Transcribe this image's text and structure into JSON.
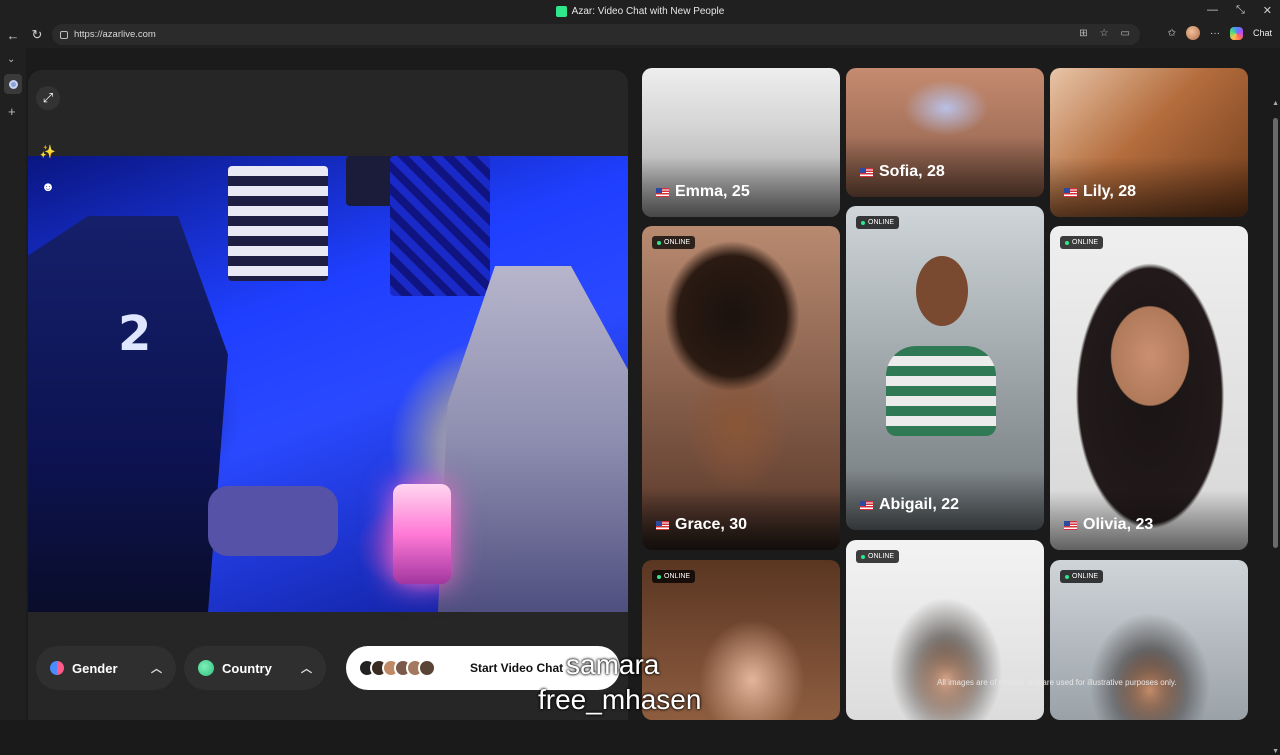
{
  "browser": {
    "window_title": "Azar: Video Chat with New People",
    "url": "https://azarlive.com",
    "chat_label": "Chat",
    "controls": [
      "—",
      "⤡",
      "✕"
    ]
  },
  "filters": {
    "gender_label": "Gender",
    "country_label": "Country",
    "start_label": "Start Video Chat"
  },
  "profiles": [
    {
      "name": "Emma, 25",
      "online": false
    },
    {
      "name": "Sofia, 28",
      "online": false
    },
    {
      "name": "Lily, 28",
      "online": false
    },
    {
      "name": "Grace, 30",
      "online": true
    },
    {
      "name": "Abigail, 22",
      "online": true
    },
    {
      "name": "Olivia, 23",
      "online": true
    },
    {
      "name": "",
      "online": true
    },
    {
      "name": "",
      "online": true
    },
    {
      "name": "",
      "online": true
    }
  ],
  "online_badge": "ONLINE",
  "disclaimer": "All images are of models and are used for illustrative purposes only.",
  "overlay": {
    "line1": "samara",
    "line2": "free_mhasen"
  },
  "colors": {
    "accent_green": "#2ee88b",
    "page_bg": "#1b1b1b"
  }
}
